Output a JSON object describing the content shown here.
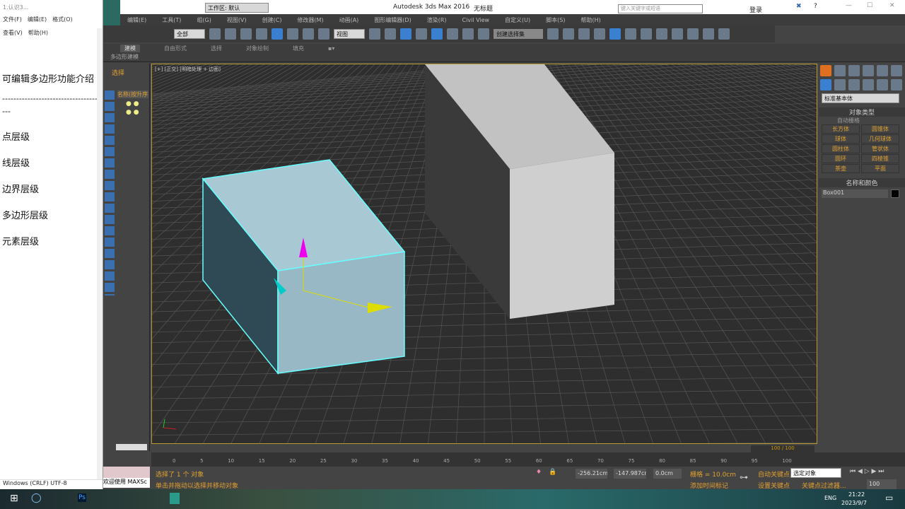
{
  "notepad": {
    "title": "1.认识3...",
    "menu": [
      "文件(F)",
      "编辑(E)",
      "格式(O)",
      "查看(V)",
      "帮助(H)"
    ],
    "lines": [
      "可编辑多边形功能介绍",
      "-------------------------------------",
      "点层级",
      "线层级",
      "边界层级",
      "多边形层级",
      "元素层级"
    ],
    "status": "Windows (CRLF)  UTF-8"
  },
  "app": {
    "title": "Autodesk 3ds Max 2016",
    "doc": "无标题",
    "workspace": "工作区: 默认",
    "search_placeholder": "键入关键字或短语",
    "login": "登录",
    "menu": [
      "编辑(E)",
      "工具(T)",
      "组(G)",
      "视图(V)",
      "创建(C)",
      "修改器(M)",
      "动画(A)",
      "图形编辑器(D)",
      "渲染(R)",
      "Civil View",
      "自定义(U)",
      "脚本(S)",
      "帮助(H)"
    ],
    "toolbar": {
      "filter": "全部",
      "ref_coord": "视图",
      "selection_set": "创建选择集"
    },
    "ribbon": {
      "tabs": [
        "建模",
        "自由形式",
        "选择",
        "对象绘制",
        "填充"
      ],
      "sub": "多边形建模"
    },
    "left": {
      "label": "选择",
      "explorer_header": "名称(按升序"
    },
    "viewport_label": "[+] [正交] [明暗处理 + 边面]",
    "cmd": {
      "dropdown": "标准基本体",
      "object_type": "对象类型",
      "autogrid": "自动栅格",
      "buttons": [
        "长方体",
        "圆锥体",
        "球体",
        "几何球体",
        "圆柱体",
        "管状体",
        "圆环",
        "四棱锥",
        "茶壶",
        "平面"
      ],
      "name_color": "名称和颜色",
      "name": "Box001",
      "color": "#000000"
    },
    "timeline": {
      "frame": "100 / 100",
      "ticks": [
        "0",
        "5",
        "10",
        "15",
        "20",
        "25",
        "30",
        "35",
        "40",
        "45",
        "50",
        "55",
        "60",
        "65",
        "70",
        "75",
        "80",
        "85",
        "90",
        "95",
        "100"
      ]
    },
    "status": {
      "selected": "选择了 1 个 对象",
      "hint": "单击并拖动以选择并移动对象",
      "maxscript": "欢迎使用 MAXSc",
      "x": "-256.21cm",
      "y": "-147.987cr",
      "z": "0.0cm",
      "grid": "栅格 = 10.0cm",
      "add_time_tag": "添加时间标记",
      "auto_key": "自动关键点",
      "set_key": "设置关键点",
      "key_filter": "关键点过滤器...",
      "selected_obj": "选定对象",
      "frame": "100"
    }
  },
  "taskbar": {
    "lang": "ENG",
    "time": "21:22",
    "date": "2023/9/7"
  }
}
